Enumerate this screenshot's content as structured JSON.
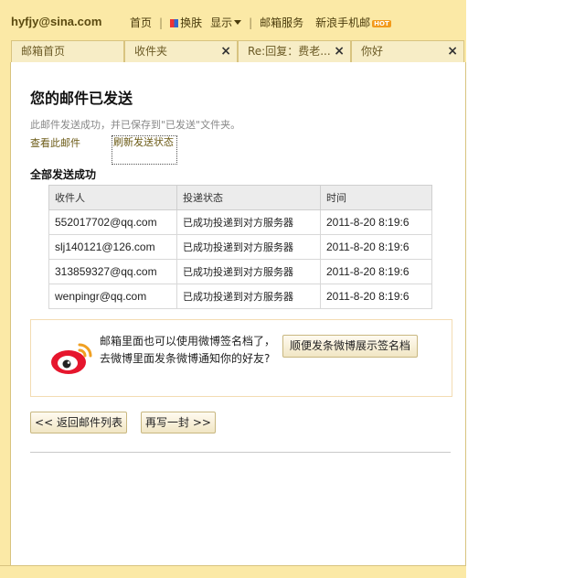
{
  "header": {
    "account": "hyfjy@sina.com",
    "nav": {
      "home": "首页",
      "skin": "换肤",
      "display": "显示",
      "mail_service": "邮箱服务",
      "mobile_mail": "新浪手机邮",
      "hot_badge": "HOT"
    }
  },
  "tabs": [
    {
      "label": "邮箱首页",
      "closable": false
    },
    {
      "label": "收件夹",
      "closable": true
    },
    {
      "label": "Re:回复：费老...",
      "closable": true
    },
    {
      "label": "你好",
      "closable": true
    }
  ],
  "main": {
    "title": "您的邮件已发送",
    "subtext": "此邮件发送成功，并已保存到\"已发送\"文件夹。",
    "view_link": "查看此邮件",
    "refresh_link": "刷新发送状态",
    "section_title": "全部发送成功",
    "table": {
      "headers": [
        "收件人",
        "投递状态",
        "时间"
      ],
      "rows": [
        [
          "552017702@qq.com",
          "已成功投递到对方服务器",
          "2011-8-20 8:19:6"
        ],
        [
          "slj140121@126.com",
          "已成功投递到对方服务器",
          "2011-8-20 8:19:6"
        ],
        [
          "313859327@qq.com",
          "已成功投递到对方服务器",
          "2011-8-20 8:19:6"
        ],
        [
          "wenpingr@qq.com",
          "已成功投递到对方服务器",
          "2011-8-20 8:19:6"
        ]
      ]
    },
    "weibo": {
      "line1": "邮箱里面也可以使用微博签名档了，",
      "line2": "去微博里面发条微博通知你的好友?",
      "button": "顺便发条微博展示签名档"
    },
    "back_button": "<< 返回邮件列表",
    "rewrite_button": "再写一封 >>"
  },
  "colors": {
    "header_bg": "#fbe9a6",
    "link": "#6b5a15",
    "weibo_border": "#f3dcb2"
  }
}
